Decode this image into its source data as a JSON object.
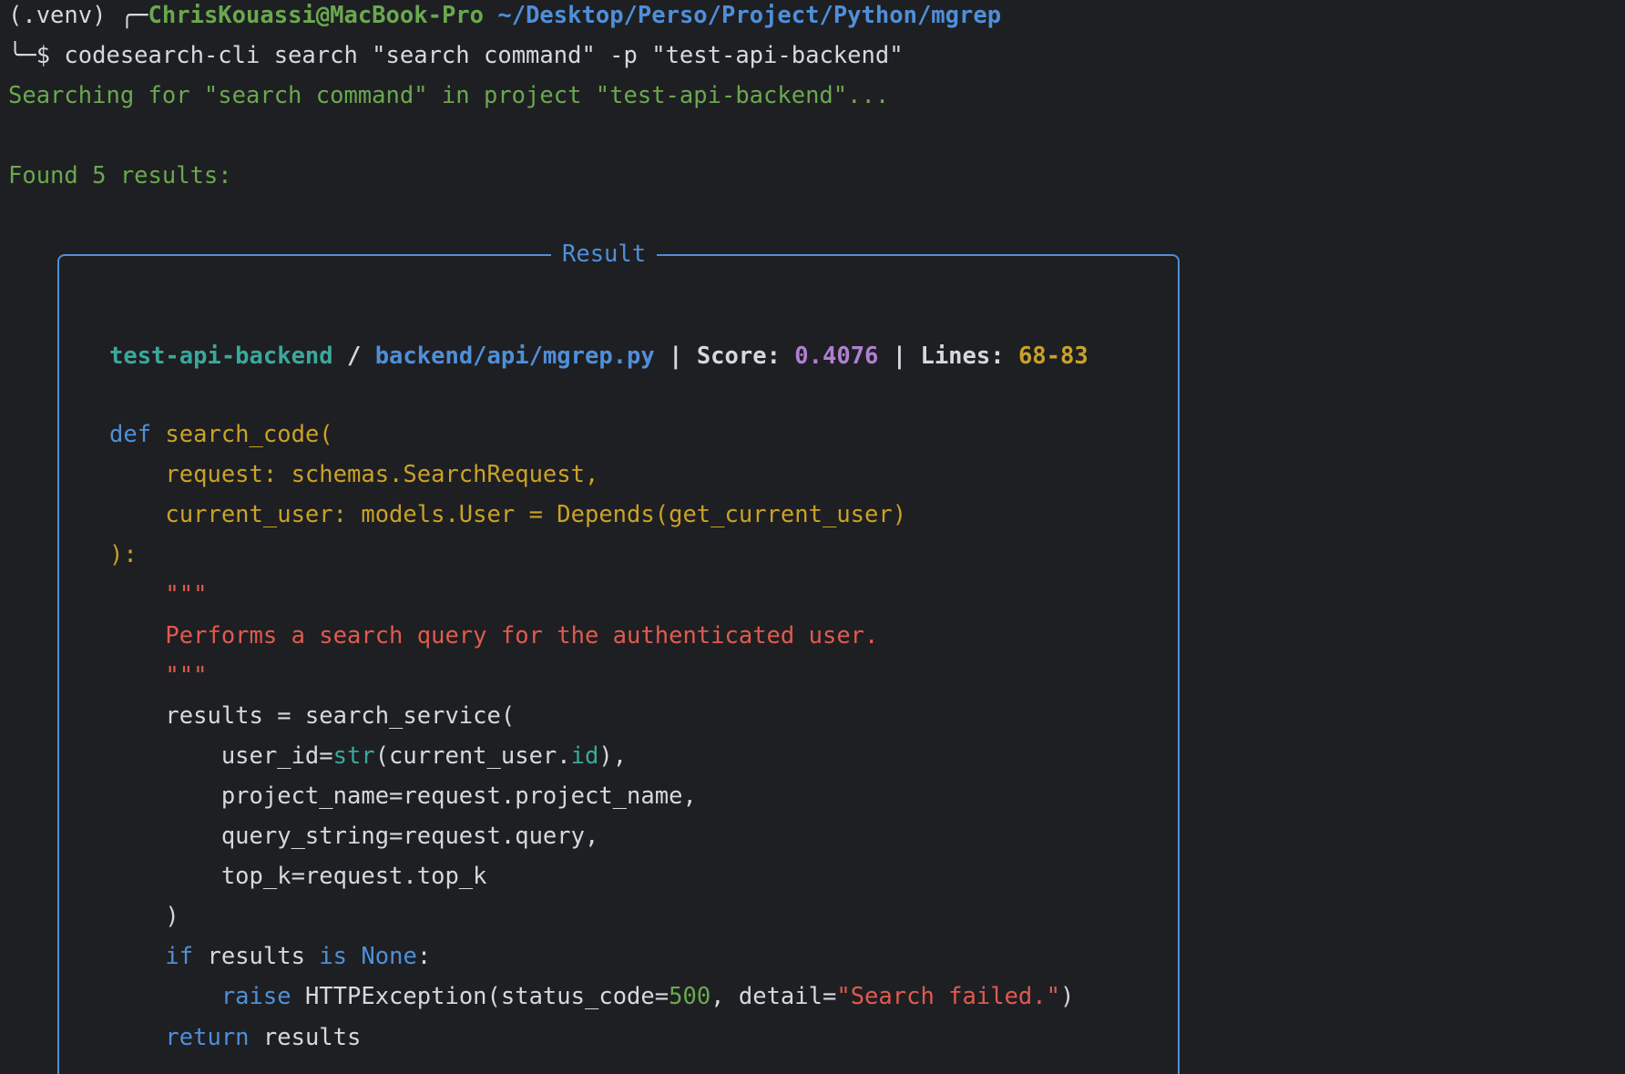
{
  "prompt": {
    "venv": "(.venv)",
    "corner_top": "╭─",
    "user_host": "ChrisKouassi@MacBook-Pro",
    "cwd": "~/Desktop/Perso/Project/Python/mgrep",
    "corner_bottom": "╰─$",
    "command": "codesearch-cli search \"search command\" -p \"test-api-backend\""
  },
  "output": {
    "searching": "Searching for \"search command\" in project \"test-api-backend\"...",
    "found": "Found 5 results:"
  },
  "result": {
    "title": "Result",
    "project": "test-api-backend",
    "separator": " / ",
    "file": "backend/api/mgrep.py",
    "pipe1": " | ",
    "score_label": "Score: ",
    "score": "0.4076",
    "pipe2": " | ",
    "lines_label": "Lines: ",
    "lines": "68-83"
  },
  "code": [
    [
      {
        "t": "def",
        "c": "kw"
      },
      {
        "t": " search_code(",
        "c": "fn"
      }
    ],
    [
      {
        "t": "    request: schemas.SearchRequest,",
        "c": "fn"
      }
    ],
    [
      {
        "t": "    current_user: models.User = Depends(get_current_user)",
        "c": "fn"
      }
    ],
    [
      {
        "t": "):",
        "c": "fn"
      }
    ],
    [
      {
        "t": "    \"\"\"",
        "c": "str"
      }
    ],
    [
      {
        "t": "    Performs a search query for the authenticated user.",
        "c": "str"
      }
    ],
    [
      {
        "t": "    \"\"\"",
        "c": "str"
      }
    ],
    [
      {
        "t": "    results = search_service(",
        "c": "plain"
      }
    ],
    [
      {
        "t": "        user_id=",
        "c": "plain"
      },
      {
        "t": "str",
        "c": "builtin"
      },
      {
        "t": "(current_user.",
        "c": "plain"
      },
      {
        "t": "id",
        "c": "builtin"
      },
      {
        "t": "),",
        "c": "plain"
      }
    ],
    [
      {
        "t": "        project_name=request.project_name,",
        "c": "plain"
      }
    ],
    [
      {
        "t": "        query_string=request.query,",
        "c": "plain"
      }
    ],
    [
      {
        "t": "        top_k=request.top_k",
        "c": "plain"
      }
    ],
    [
      {
        "t": "    )",
        "c": "plain"
      }
    ],
    [
      {
        "t": "    ",
        "c": "plain"
      },
      {
        "t": "if",
        "c": "kw"
      },
      {
        "t": " results ",
        "c": "plain"
      },
      {
        "t": "is",
        "c": "kw"
      },
      {
        "t": " ",
        "c": "plain"
      },
      {
        "t": "None",
        "c": "kw"
      },
      {
        "t": ":",
        "c": "plain"
      }
    ],
    [
      {
        "t": "        ",
        "c": "plain"
      },
      {
        "t": "raise",
        "c": "kw"
      },
      {
        "t": " HTTPException(status_code=",
        "c": "plain"
      },
      {
        "t": "500",
        "c": "num"
      },
      {
        "t": ", detail=",
        "c": "plain"
      },
      {
        "t": "\"Search failed.\"",
        "c": "str"
      },
      {
        "t": ")",
        "c": "plain"
      }
    ],
    [
      {
        "t": "    ",
        "c": "plain"
      },
      {
        "t": "return",
        "c": "kw"
      },
      {
        "t": " results",
        "c": "plain"
      }
    ]
  ]
}
